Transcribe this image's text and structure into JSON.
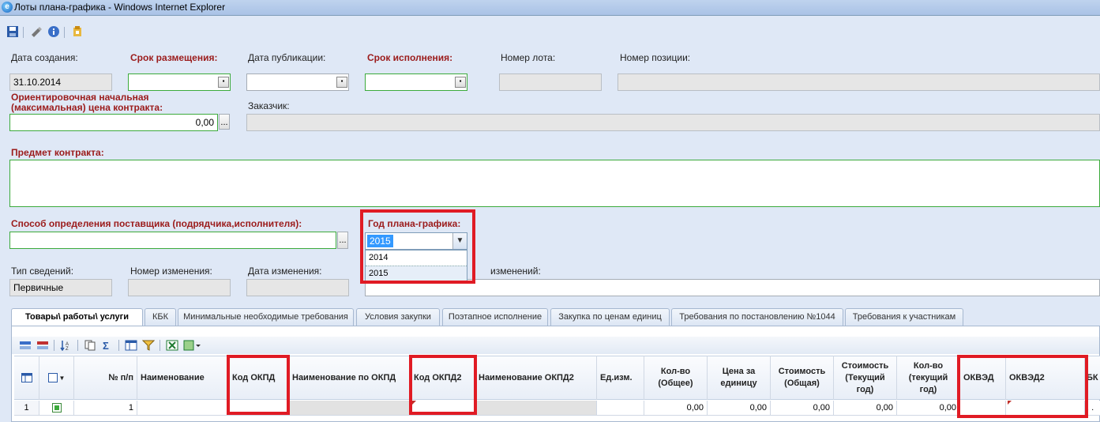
{
  "window": {
    "title": "Лоты плана-графика - Windows Internet Explorer"
  },
  "toolbar": {
    "icons": [
      "save-icon",
      "edit-icon",
      "info-icon",
      "export-icon"
    ]
  },
  "form": {
    "created_label": "Дата создания:",
    "created_value": "31.10.2014",
    "placement_label": "Срок размещения:",
    "publication_label": "Дата публикации:",
    "execution_label": "Срок исполнения:",
    "lot_number_label": "Номер лота:",
    "position_number_label": "Номер позиции:",
    "price_label_line1": "Ориентировочная начальная",
    "price_label_line2": "(максимальная) цена контракта:",
    "price_value": "0,00",
    "customer_label": "Заказчик:",
    "subject_label": "Предмет контракта:",
    "method_label": "Способ определения поставщика (подрядчика,исполнителя):",
    "year_label": "Год плана-графика:",
    "year_value": "2015",
    "year_options": [
      "2014",
      "2015"
    ],
    "info_type_label": "Тип сведений:",
    "info_type_value": "Первичные",
    "change_number_label": "Номер изменения:",
    "change_date_label": "Дата изменения:",
    "change_reason_label": "изменений:",
    "dots": "..."
  },
  "tabs": [
    "Товары\\ работы\\ услуги",
    "КБК",
    "Минимальные необходимые требования",
    "Условия закупки",
    "Поэтапное исполнение",
    "Закупка по ценам единиц",
    "Требования по постановлению №1044",
    "Требования к участникам"
  ],
  "grid": {
    "headers": {
      "num": "№ п/п",
      "name": "Наименование",
      "okpd": "Код ОКПД",
      "okpd_name": "Наименование по ОКПД",
      "okpd2": "Код ОКПД2",
      "okpd2_name": "Наименование ОКПД2",
      "unit": "Ед.изм.",
      "qty_total": "Кол-во (Общее)",
      "unit_price": "Цена за единицу",
      "cost_total": "Стоимость (Общая)",
      "cost_current": "Стоимость (Текущий год)",
      "qty_current": "Кол-во (текущий год)",
      "okved": "ОКВЭД",
      "okved2": "ОКВЭД2",
      "bk": "БК"
    },
    "row": {
      "index": "1",
      "num": "1",
      "qty_total": "0,00",
      "unit_price": "0,00",
      "cost_total": "0,00",
      "cost_current": "0,00",
      "qty_current": "0,00",
      "tail": ". ."
    }
  },
  "colors": {
    "highlight": "#e01b24",
    "required": "#9b1b1b",
    "valid_border": "#3caa3c"
  }
}
